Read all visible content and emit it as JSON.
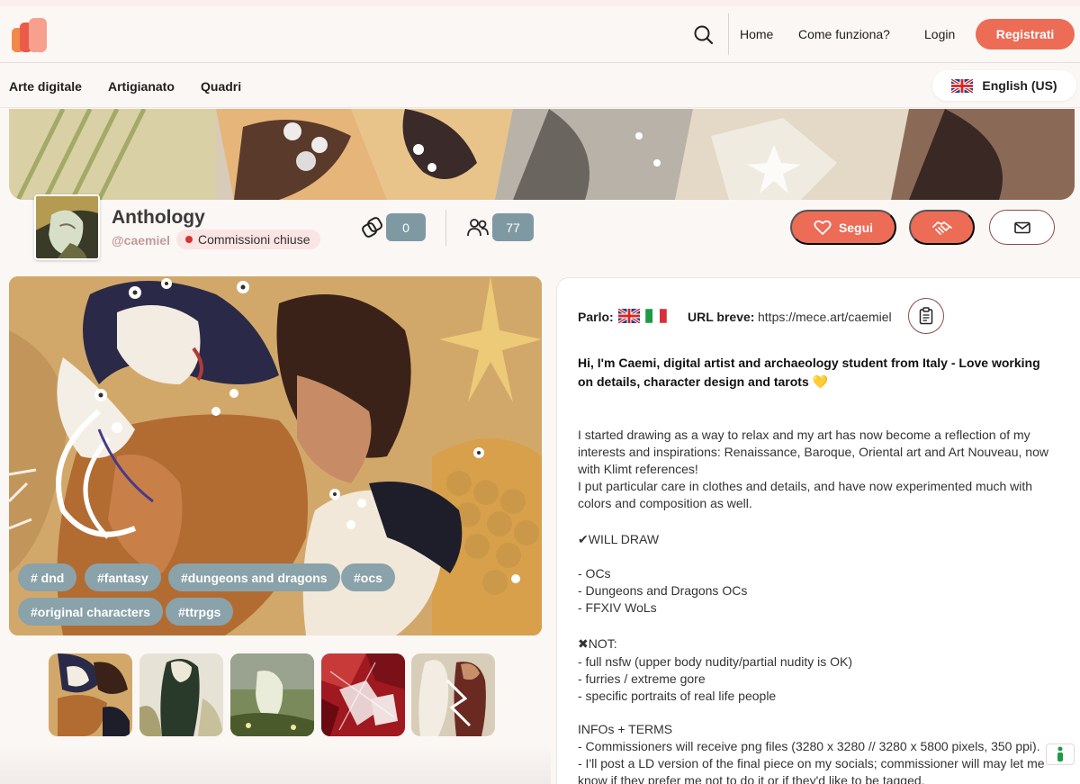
{
  "header": {
    "nav": {
      "home": "Home",
      "how_it_works": "Come funziona?",
      "login": "Login",
      "register": "Registrati"
    }
  },
  "categories": [
    "Arte digitale",
    "Artigianato",
    "Quadri"
  ],
  "language": {
    "label": "English (US)"
  },
  "profile": {
    "name": "Anthology",
    "handle": "@caemiel",
    "status": "Commissioni chiuse",
    "collections_count": "0",
    "followers_count": "77",
    "follow_label": "Segui"
  },
  "artwork": {
    "tags": [
      "# dnd",
      "#fantasy",
      "#dungeons and dragons",
      "#ocs",
      "#original characters",
      "#ttrpgs"
    ]
  },
  "info": {
    "speaks_label": "Parlo:",
    "short_url_label": "URL breve:",
    "short_url": "https://mece.art/caemiel",
    "headline": "Hi, I'm Caemi, digital artist and archaeology student from Italy - Love working on details, character design and tarots 💛",
    "bio_lines": [
      "I started drawing as a way to relax and my art has now become a reflection of my",
      "interests and inspirations: Renaissance, Baroque, Oriental art and Art Nouveau, now",
      "with Klimt references!",
      "I put particular care in clothes and details, and have now experimented much with",
      "colors and composition as well.",
      "✔WILL DRAW",
      "- OCs",
      "- Dungeons and Dragons OCs",
      "- FFXIV WoLs",
      "✖NOT:",
      "- full nsfw (upper body nudity/partial nudity is OK)",
      "- furries / extreme gore",
      "- specific portraits of real life people",
      "INFOs + TERMS",
      "- Commissioners will receive png files (3280 x 3280 // 3280 x 5800 pixels, 350 ppi).",
      "- I'll post a LD version of the final piece on my socials; commissioner will may let me",
      "know if they prefer me not to do it or if they'd like to be tagged."
    ]
  },
  "colors": {
    "accent": "#ec6c56",
    "tag": "#8aa2aa",
    "stat_pill": "#7f99a3",
    "status_dot": "#d8342f"
  }
}
